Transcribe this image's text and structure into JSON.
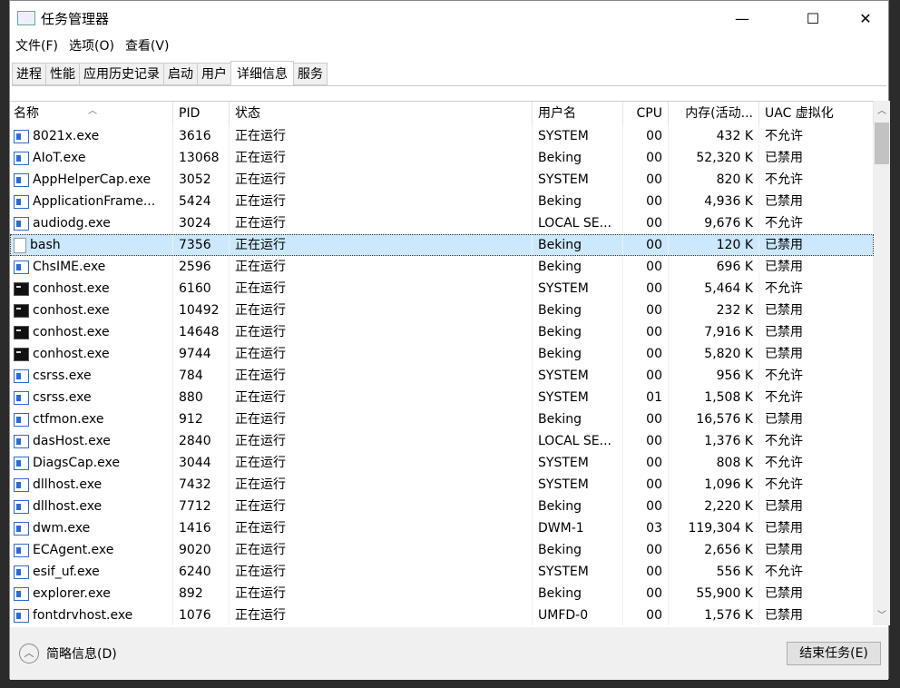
{
  "window": {
    "title": "任务管理器",
    "minimize": "—",
    "maximize": "☐",
    "close": "✕"
  },
  "menu": [
    "文件(F)",
    "选项(O)",
    "查看(V)"
  ],
  "tabs": [
    "进程",
    "性能",
    "应用历史记录",
    "启动",
    "用户",
    "详细信息",
    "服务"
  ],
  "active_tab": "详细信息",
  "columns": [
    "名称",
    "PID",
    "状态",
    "用户名",
    "CPU",
    "内存(活动...",
    "UAC 虚拟化"
  ],
  "rows": [
    [
      "8021x.exe",
      "3616",
      "正在运行",
      "SYSTEM",
      "00",
      "432 K",
      "不允许",
      "app"
    ],
    [
      "AIoT.exe",
      "13068",
      "正在运行",
      "Beking",
      "00",
      "52,320 K",
      "已禁用",
      "app"
    ],
    [
      "AppHelperCap.exe",
      "3052",
      "正在运行",
      "SYSTEM",
      "00",
      "820 K",
      "不允许",
      "app"
    ],
    [
      "ApplicationFrame...",
      "5424",
      "正在运行",
      "Beking",
      "00",
      "4,936 K",
      "已禁用",
      "app"
    ],
    [
      "audiodg.exe",
      "3024",
      "正在运行",
      "LOCAL SE...",
      "00",
      "9,676 K",
      "不允许",
      "app"
    ],
    [
      "bash",
      "7356",
      "正在运行",
      "Beking",
      "00",
      "120 K",
      "已禁用",
      "blank"
    ],
    [
      "ChsIME.exe",
      "2596",
      "正在运行",
      "Beking",
      "00",
      "696 K",
      "已禁用",
      "app"
    ],
    [
      "conhost.exe",
      "6160",
      "正在运行",
      "SYSTEM",
      "00",
      "5,464 K",
      "不允许",
      "console"
    ],
    [
      "conhost.exe",
      "10492",
      "正在运行",
      "Beking",
      "00",
      "232 K",
      "已禁用",
      "console"
    ],
    [
      "conhost.exe",
      "14648",
      "正在运行",
      "Beking",
      "00",
      "7,916 K",
      "已禁用",
      "console"
    ],
    [
      "conhost.exe",
      "9744",
      "正在运行",
      "Beking",
      "00",
      "5,820 K",
      "已禁用",
      "console"
    ],
    [
      "csrss.exe",
      "784",
      "正在运行",
      "SYSTEM",
      "00",
      "956 K",
      "不允许",
      "app"
    ],
    [
      "csrss.exe",
      "880",
      "正在运行",
      "SYSTEM",
      "01",
      "1,508 K",
      "不允许",
      "app"
    ],
    [
      "ctfmon.exe",
      "912",
      "正在运行",
      "Beking",
      "00",
      "16,576 K",
      "已禁用",
      "app"
    ],
    [
      "dasHost.exe",
      "2840",
      "正在运行",
      "LOCAL SE...",
      "00",
      "1,376 K",
      "不允许",
      "app"
    ],
    [
      "DiagsCap.exe",
      "3044",
      "正在运行",
      "SYSTEM",
      "00",
      "808 K",
      "不允许",
      "app"
    ],
    [
      "dllhost.exe",
      "7432",
      "正在运行",
      "SYSTEM",
      "00",
      "1,096 K",
      "不允许",
      "app"
    ],
    [
      "dllhost.exe",
      "7712",
      "正在运行",
      "Beking",
      "00",
      "2,220 K",
      "已禁用",
      "app"
    ],
    [
      "dwm.exe",
      "1416",
      "正在运行",
      "DWM-1",
      "03",
      "119,304 K",
      "已禁用",
      "app"
    ],
    [
      "ECAgent.exe",
      "9020",
      "正在运行",
      "Beking",
      "00",
      "2,656 K",
      "已禁用",
      "app"
    ],
    [
      "esif_uf.exe",
      "6240",
      "正在运行",
      "SYSTEM",
      "00",
      "556 K",
      "不允许",
      "app"
    ],
    [
      "explorer.exe",
      "892",
      "正在运行",
      "Beking",
      "00",
      "55,900 K",
      "已禁用",
      "app"
    ],
    [
      "fontdrvhost.exe",
      "1076",
      "正在运行",
      "UMFD-0",
      "00",
      "1,576 K",
      "已禁用",
      "app"
    ]
  ],
  "selected_row": 5,
  "footer": {
    "brief": "简略信息(D)",
    "end_task": "结束任务(E)"
  }
}
